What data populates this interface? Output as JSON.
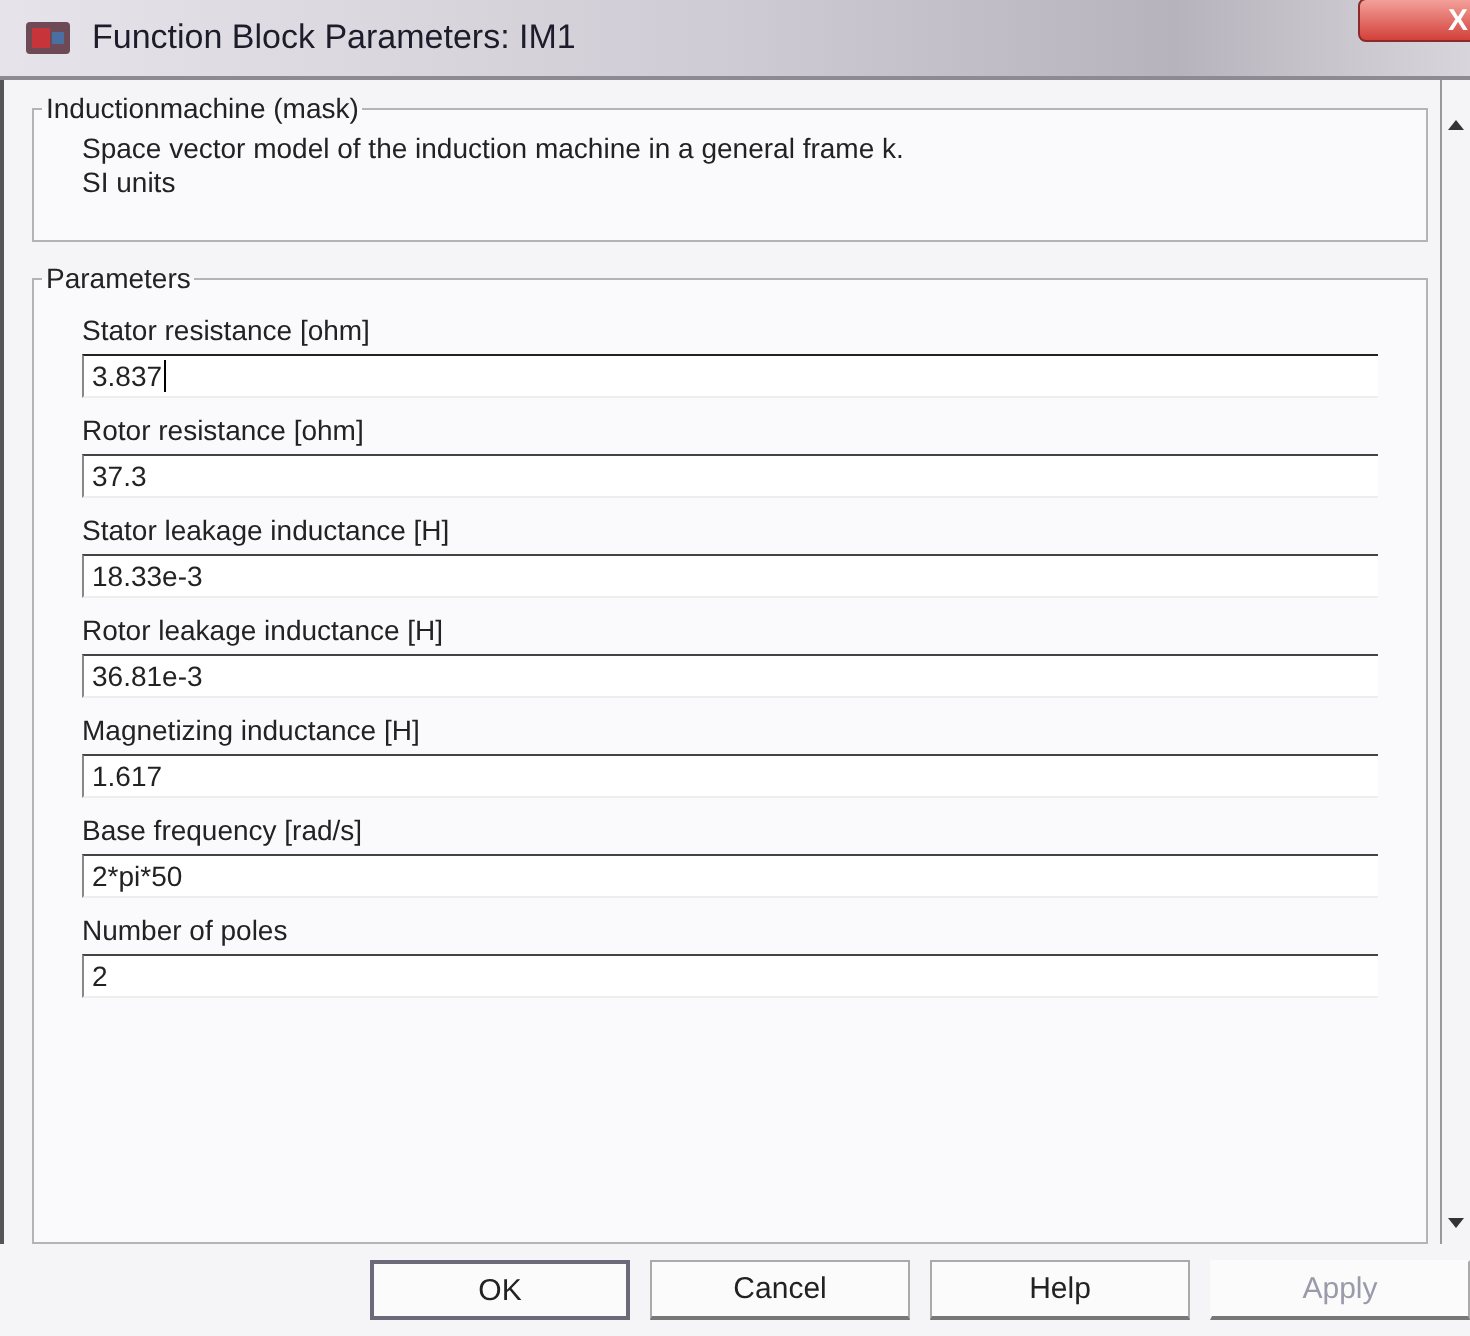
{
  "window": {
    "title": "Function Block Parameters: IM1",
    "close": "X"
  },
  "mask": {
    "title": "Inductionmachine (mask)",
    "lines": [
      "Space vector model of the induction machine in a general frame k.",
      "SI units"
    ]
  },
  "parameters": {
    "title": "Parameters",
    "fields": [
      {
        "label": "Stator resistance [ohm]",
        "value": "3.837",
        "focused": true
      },
      {
        "label": "Rotor resistance [ohm]",
        "value": "37.3",
        "focused": false
      },
      {
        "label": "Stator leakage inductance  [H]",
        "value": "18.33e-3",
        "focused": false
      },
      {
        "label": "Rotor leakage inductance [H]",
        "value": "36.81e-3",
        "focused": false
      },
      {
        "label": "Magnetizing inductance [H]",
        "value": "1.617",
        "focused": false
      },
      {
        "label": "Base frequency [rad/s]",
        "value": "2*pi*50",
        "focused": false
      },
      {
        "label": "Number of poles",
        "value": "2",
        "focused": false
      }
    ]
  },
  "buttons": [
    {
      "label": "OK",
      "disabled": false,
      "default": true
    },
    {
      "label": "Cancel",
      "disabled": false,
      "default": false
    },
    {
      "label": "Help",
      "disabled": false,
      "default": false
    },
    {
      "label": "Apply",
      "disabled": true,
      "default": false
    }
  ]
}
